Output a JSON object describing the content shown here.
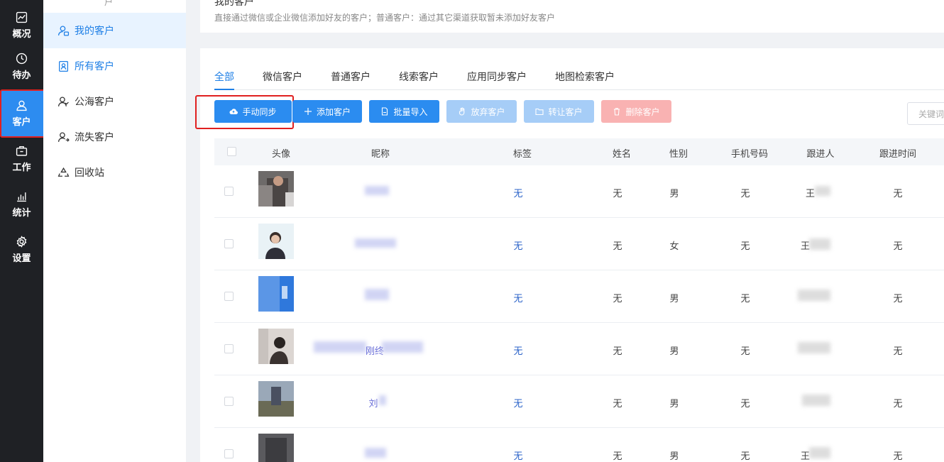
{
  "rail": {
    "items": [
      {
        "label": "概况",
        "icon": "chart-line-icon"
      },
      {
        "label": "待办",
        "icon": "clock-icon"
      },
      {
        "label": "客户",
        "icon": "user-icon"
      },
      {
        "label": "工作",
        "icon": "briefcase-icon"
      },
      {
        "label": "统计",
        "icon": "bar-chart-icon"
      },
      {
        "label": "设置",
        "icon": "gear-icon"
      }
    ],
    "active_color": "#2d8cf0"
  },
  "submenu": {
    "stub": "户",
    "items": [
      {
        "label": "我的客户",
        "icon": "user-check-icon"
      },
      {
        "label": "所有客户",
        "icon": "contact-book-icon"
      },
      {
        "label": "公海客户",
        "icon": "user-group-icon"
      },
      {
        "label": "流失客户",
        "icon": "user-leave-icon"
      },
      {
        "label": "回收站",
        "icon": "recycle-icon"
      }
    ]
  },
  "header": {
    "title": "我的客户",
    "description": "直接通过微信或企业微信添加好友的客户；普通客户：通过其它渠道获取暂未添加好友客户"
  },
  "tabs": [
    "全部",
    "微信客户",
    "普通客户",
    "线索客户",
    "应用同步客户",
    "地图检索客户"
  ],
  "toolbar": {
    "sync": "手动同步",
    "add": "添加客户",
    "import": "批量导入",
    "abandon": "放弃客户",
    "transfer": "转让客户",
    "delete": "删除客户",
    "search_placeholder": "关键词"
  },
  "table": {
    "headers": {
      "avatar": "头像",
      "nickname": "昵称",
      "tag": "标签",
      "name": "姓名",
      "gender": "性别",
      "phone": "手机号码",
      "follower": "跟进人",
      "follow_time": "跟进时间"
    },
    "rows": [
      {
        "nickname": "",
        "tag": "无",
        "name": "无",
        "gender": "男",
        "phone": "无",
        "follower": "王",
        "follow_time": "无"
      },
      {
        "nickname": "",
        "tag": "无",
        "name": "无",
        "gender": "女",
        "phone": "无",
        "follower": "王",
        "follow_time": "无"
      },
      {
        "nickname": "",
        "tag": "无",
        "name": "无",
        "gender": "男",
        "phone": "无",
        "follower": "",
        "follow_time": "无"
      },
      {
        "nickname": "刚终",
        "tag": "无",
        "name": "无",
        "gender": "男",
        "phone": "无",
        "follower": "",
        "follow_time": "无"
      },
      {
        "nickname": "刘",
        "tag": "无",
        "name": "无",
        "gender": "男",
        "phone": "无",
        "follower": "",
        "follow_time": "无"
      },
      {
        "nickname": "",
        "tag": "无",
        "name": "无",
        "gender": "男",
        "phone": "无",
        "follower": "王",
        "follow_time": "无"
      }
    ]
  }
}
